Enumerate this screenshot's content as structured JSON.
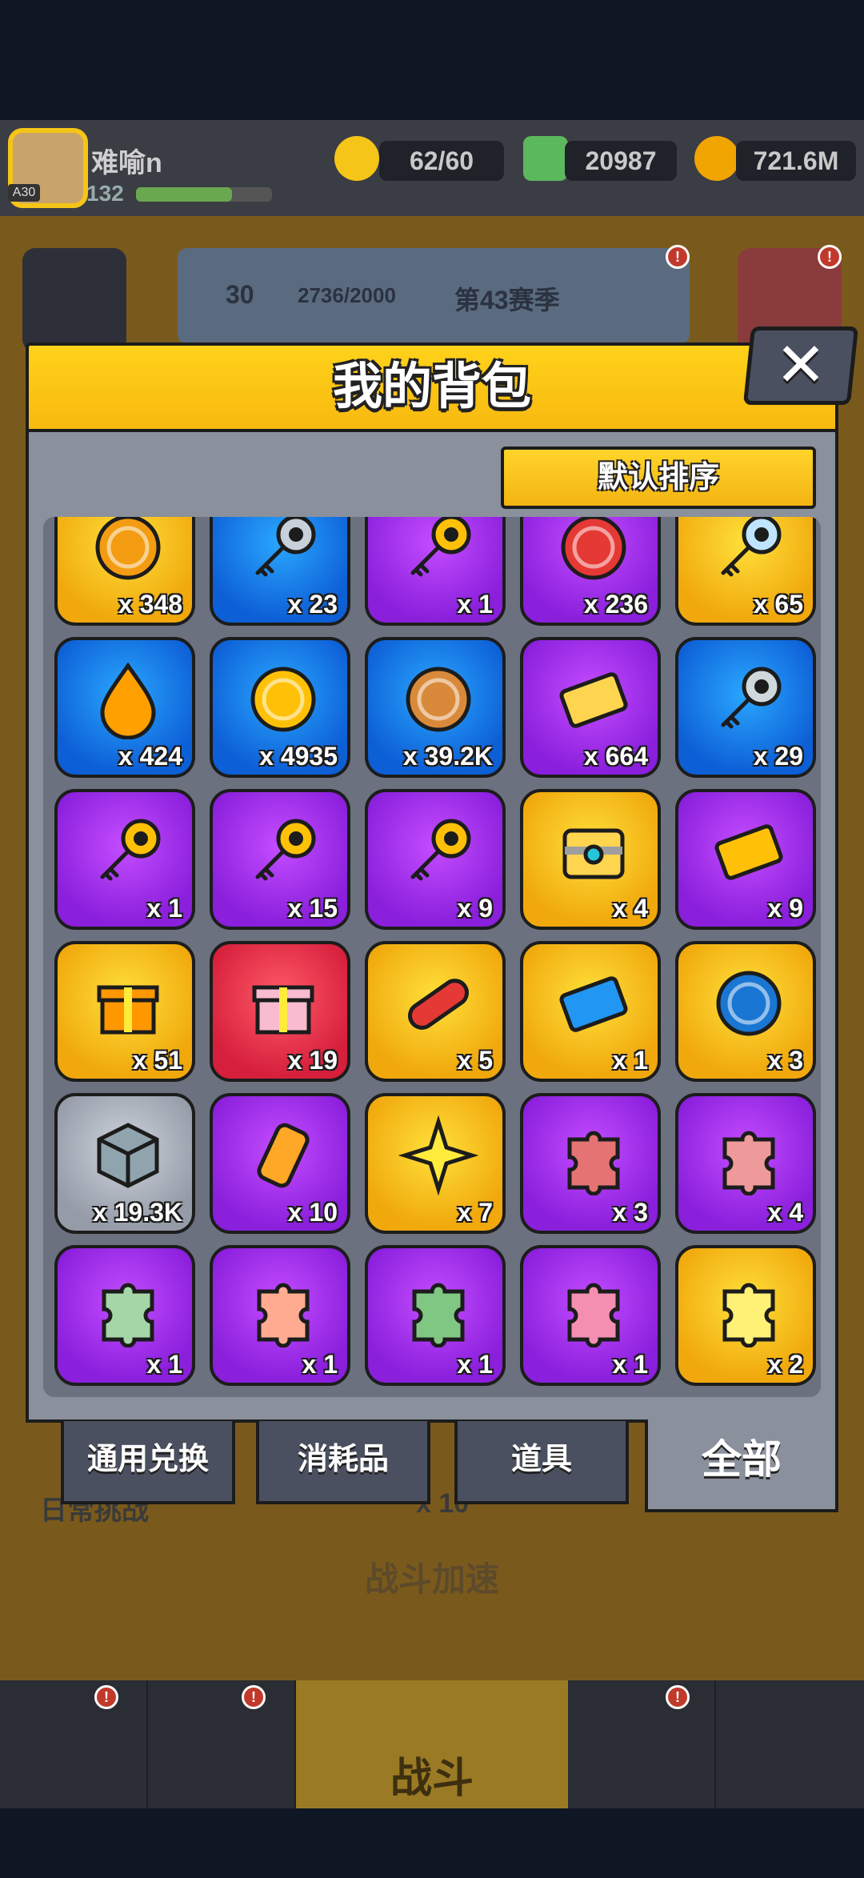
{
  "player": {
    "name": "难喻n",
    "level": "132",
    "avatar_level": "A30"
  },
  "resources": [
    {
      "name": "energy",
      "value": "62/60",
      "color": "#f5c518",
      "icon": "lightning-icon"
    },
    {
      "name": "gems",
      "value": "20987",
      "color": "#5cb85c",
      "icon": "gem-icon"
    },
    {
      "name": "gold",
      "value": "721.6M",
      "color": "#f0a500",
      "icon": "coin-icon"
    }
  ],
  "season": {
    "level": "30",
    "progress": "2736/2000",
    "label": "第43赛季"
  },
  "background": {
    "speed_label": "战斗加速",
    "battle_label": "战斗",
    "left_label": "日常挑战",
    "mid_label": "x 10"
  },
  "modal": {
    "title": "我的背包",
    "sort_label": "默认排序",
    "close_glyph": "✕"
  },
  "items": [
    {
      "rarity": "gold",
      "icon": "dna-orb-icon",
      "qty": "x 348",
      "color": "#f39c12"
    },
    {
      "rarity": "blue",
      "icon": "silver-key-icon",
      "qty": "x 23",
      "color": "#c8d0da"
    },
    {
      "rarity": "purple",
      "icon": "gold-key-icon",
      "qty": "x 1",
      "color": "#ffc107"
    },
    {
      "rarity": "purple",
      "icon": "heart-coin-icon",
      "qty": "x 236",
      "color": "#e53935"
    },
    {
      "rarity": "gold",
      "icon": "diamond-key-icon",
      "qty": "x 65",
      "color": "#bfe4ff"
    },
    {
      "rarity": "blue",
      "icon": "flame-drop-icon",
      "qty": "x 424",
      "color": "#ffa000"
    },
    {
      "rarity": "blue",
      "icon": "gold-coin-icon",
      "qty": "x 4935",
      "color": "#ffc107"
    },
    {
      "rarity": "blue",
      "icon": "bear-cookie-icon",
      "qty": "x 39.2K",
      "color": "#d88a3a"
    },
    {
      "rarity": "purple",
      "icon": "gold-ticket-icon",
      "qty": "x 664",
      "color": "#ffd54f"
    },
    {
      "rarity": "blue",
      "icon": "cat-key-icon",
      "qty": "x 29",
      "color": "#cfd8dc"
    },
    {
      "rarity": "purple",
      "icon": "bear-key-icon",
      "qty": "x 1",
      "color": "#ffc107"
    },
    {
      "rarity": "purple",
      "icon": "gem-key-icon",
      "qty": "x 15",
      "color": "#ffc107"
    },
    {
      "rarity": "purple",
      "icon": "hex-key-icon",
      "qty": "x 9",
      "color": "#ffc107"
    },
    {
      "rarity": "gold",
      "icon": "treasure-chest-icon",
      "qty": "x 4",
      "color": "#9e9e9e"
    },
    {
      "rarity": "purple",
      "icon": "diamond-card-icon",
      "qty": "x 9",
      "color": "#ffc107"
    },
    {
      "rarity": "gold",
      "icon": "gift-box-icon",
      "qty": "x 51",
      "color": "#ff9800"
    },
    {
      "rarity": "red",
      "icon": "pink-gift-icon",
      "qty": "x 19",
      "color": "#f8bbd0"
    },
    {
      "rarity": "gold",
      "icon": "capsule-pill-icon",
      "qty": "x 5",
      "color": "#e53935"
    },
    {
      "rarity": "gold",
      "icon": "vip-ticket-icon",
      "qty": "x 1",
      "color": "#2196f3"
    },
    {
      "rarity": "gold",
      "icon": "v-coin-icon",
      "qty": "x 3",
      "color": "#1976d2"
    },
    {
      "rarity": "gray",
      "icon": "metal-cube-icon",
      "qty": "x 19.3K",
      "color": "#90a4ae"
    },
    {
      "rarity": "purple",
      "icon": "energy-canister-icon",
      "qty": "x 10",
      "color": "#ffa726"
    },
    {
      "rarity": "gold",
      "icon": "gold-star-icon",
      "qty": "x 7",
      "color": "#ffeb3b"
    },
    {
      "rarity": "purple",
      "icon": "puzzle-piece-icon",
      "qty": "x 3",
      "color": "#e57373"
    },
    {
      "rarity": "purple",
      "icon": "puzzle-piece-icon",
      "qty": "x 4",
      "color": "#ef9a9a"
    },
    {
      "rarity": "purple",
      "icon": "puzzle-piece-icon",
      "qty": "x 1",
      "color": "#a5d6a7"
    },
    {
      "rarity": "purple",
      "icon": "puzzle-piece-icon",
      "qty": "x 1",
      "color": "#ffab91"
    },
    {
      "rarity": "purple",
      "icon": "puzzle-piece-icon",
      "qty": "x 1",
      "color": "#81c784"
    },
    {
      "rarity": "purple",
      "icon": "puzzle-piece-icon",
      "qty": "x 1",
      "color": "#f48fb1"
    },
    {
      "rarity": "gold",
      "icon": "puzzle-piece-icon",
      "qty": "x 2",
      "color": "#fff176"
    }
  ],
  "tabs": [
    {
      "label": "通用兑换",
      "active": false
    },
    {
      "label": "消耗品",
      "active": false
    },
    {
      "label": "道具",
      "active": false
    },
    {
      "label": "全部",
      "active": true
    }
  ]
}
